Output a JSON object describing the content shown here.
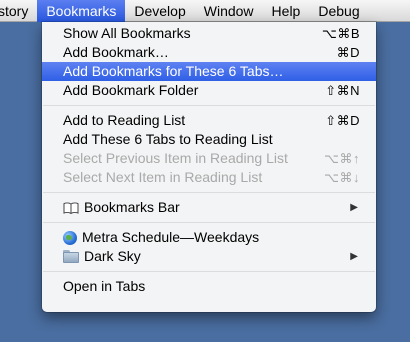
{
  "menubar": {
    "items": [
      {
        "label": "story"
      },
      {
        "label": "Bookmarks"
      },
      {
        "label": "Develop"
      },
      {
        "label": "Window"
      },
      {
        "label": "Help"
      },
      {
        "label": "Debug"
      }
    ]
  },
  "bookmarks_menu": {
    "items": [
      {
        "label": "Show All Bookmarks",
        "shortcut": "⌥⌘B"
      },
      {
        "label": "Add Bookmark…",
        "shortcut": "⌘D"
      },
      {
        "label": "Add Bookmarks for These 6 Tabs…",
        "shortcut": ""
      },
      {
        "label": "Add Bookmark Folder",
        "shortcut": "⇧⌘N"
      },
      {
        "label": "Add to Reading List",
        "shortcut": "⇧⌘D"
      },
      {
        "label": "Add These 6 Tabs to Reading List",
        "shortcut": ""
      },
      {
        "label": "Select Previous Item in Reading List",
        "shortcut": "⌥⌘↑"
      },
      {
        "label": "Select Next Item in Reading List",
        "shortcut": "⌥⌘↓"
      },
      {
        "label": "Bookmarks Bar",
        "icon": "book-icon"
      },
      {
        "label": "Metra Schedule—Weekdays",
        "icon": "globe-icon"
      },
      {
        "label": "Dark Sky",
        "icon": "folder-icon"
      },
      {
        "label": "Open in Tabs"
      }
    ],
    "highlight_color": "#2f5fe6",
    "disabled_color": "#a9a9a9"
  },
  "colors": {
    "desktop": "#4a6ea1",
    "menubar_active": "#2858e0"
  }
}
